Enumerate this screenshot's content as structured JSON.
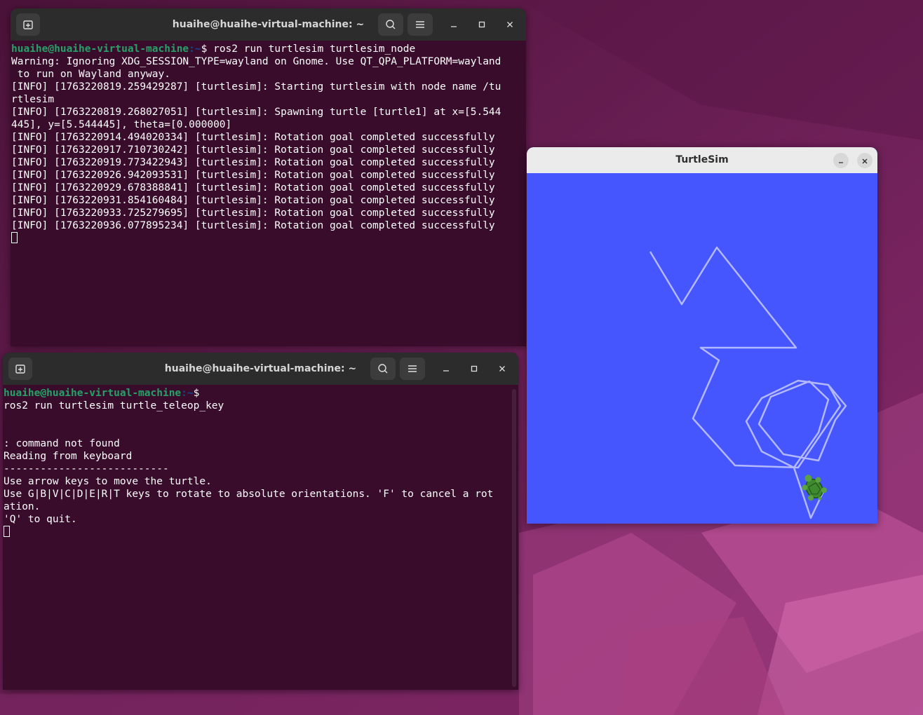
{
  "terminal_top": {
    "title": "huaihe@huaihe-virtual-machine: ~",
    "lines": [
      {
        "user": "huaihe@huaihe-virtual-machine",
        "path": ":~",
        "cmd": "$ ros2 run turtlesim turtlesim_node"
      },
      {
        "text": "Warning: Ignoring XDG_SESSION_TYPE=wayland on Gnome. Use QT_QPA_PLATFORM=wayland"
      },
      {
        "text": " to run on Wayland anyway."
      },
      {
        "text": "[INFO] [1763220819.259429287] [turtlesim]: Starting turtlesim with node name /tu"
      },
      {
        "text": "rtlesim"
      },
      {
        "text": "[INFO] [1763220819.268027051] [turtlesim]: Spawning turtle [turtle1] at x=[5.544"
      },
      {
        "text": "445], y=[5.544445], theta=[0.000000]"
      },
      {
        "text": "[INFO] [1763220914.494020334] [turtlesim]: Rotation goal completed successfully"
      },
      {
        "text": "[INFO] [1763220917.710730242] [turtlesim]: Rotation goal completed successfully"
      },
      {
        "text": "[INFO] [1763220919.773422943] [turtlesim]: Rotation goal completed successfully"
      },
      {
        "text": "[INFO] [1763220926.942093531] [turtlesim]: Rotation goal completed successfully"
      },
      {
        "text": "[INFO] [1763220929.678388841] [turtlesim]: Rotation goal completed successfully"
      },
      {
        "text": "[INFO] [1763220931.854160484] [turtlesim]: Rotation goal completed successfully"
      },
      {
        "text": "[INFO] [1763220933.725279695] [turtlesim]: Rotation goal completed successfully"
      },
      {
        "text": "[INFO] [1763220936.077895234] [turtlesim]: Rotation goal completed successfully"
      }
    ]
  },
  "terminal_bottom": {
    "title": "huaihe@huaihe-virtual-machine: ~",
    "lines": [
      {
        "user": "huaihe@huaihe-virtual-machine",
        "path": ":~",
        "cmd": "$"
      },
      {
        "text": "ros2 run turtlesim turtle_teleop_key"
      },
      {
        "text": ""
      },
      {
        "text": ""
      },
      {
        "text": ": command not found"
      },
      {
        "text": "Reading from keyboard"
      },
      {
        "text": "---------------------------"
      },
      {
        "text": "Use arrow keys to move the turtle."
      },
      {
        "text": "Use G|B|V|C|D|E|R|T keys to rotate to absolute orientations. 'F' to cancel a rot"
      },
      {
        "text": "ation."
      },
      {
        "text": "'Q' to quit."
      }
    ]
  },
  "turtlesim": {
    "title": "TurtleSim",
    "background_color": "#4556ff",
    "pen_color": "#b3b8ff",
    "turtle_icon": "turtle-icon"
  },
  "colors": {
    "terminal_bg": "#380c2a",
    "prompt_user": "#26a269",
    "prompt_path": "#12488b",
    "header_bg": "#2c2c2c"
  },
  "icons": {
    "new_tab": "new-tab-icon",
    "search": "search-icon",
    "menu": "hamburger-menu-icon",
    "minimize": "minimize-icon",
    "maximize": "maximize-icon",
    "close": "close-icon"
  }
}
